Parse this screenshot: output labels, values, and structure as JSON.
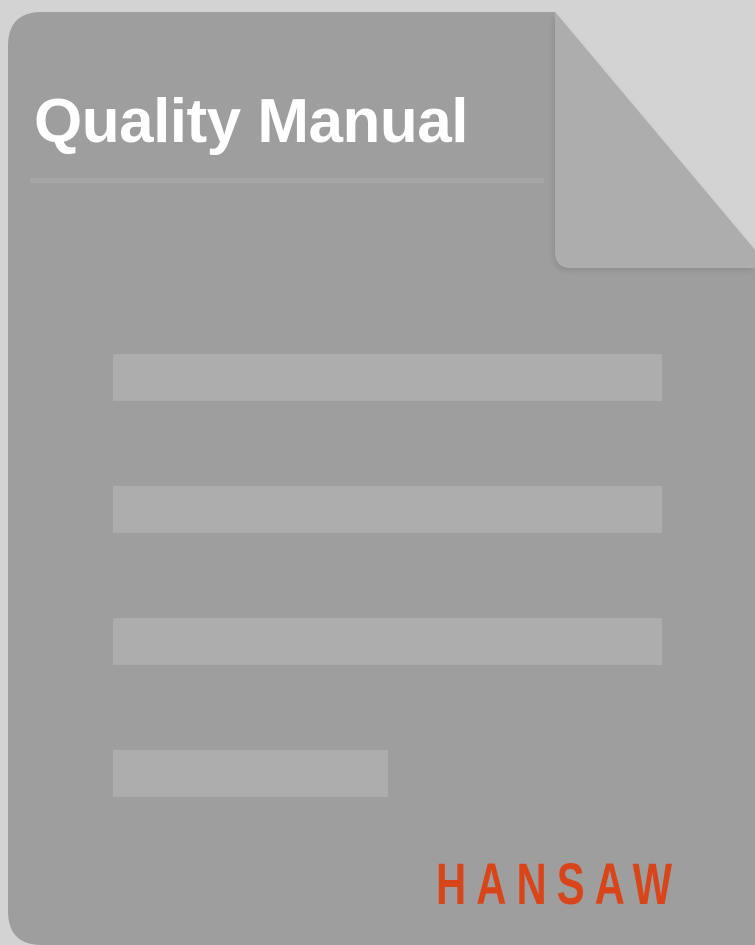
{
  "title": "Quality Manual",
  "brand": "HANSAW",
  "colors": {
    "background": "#d3d3d3",
    "sheet": "#9e9e9e",
    "fold": "#adadad",
    "text_line": "#adadad",
    "title_text": "#ffffff",
    "brand_text": "#d9451b"
  },
  "icons": {
    "document": "document-icon",
    "folded_corner": "folded-corner-icon"
  }
}
